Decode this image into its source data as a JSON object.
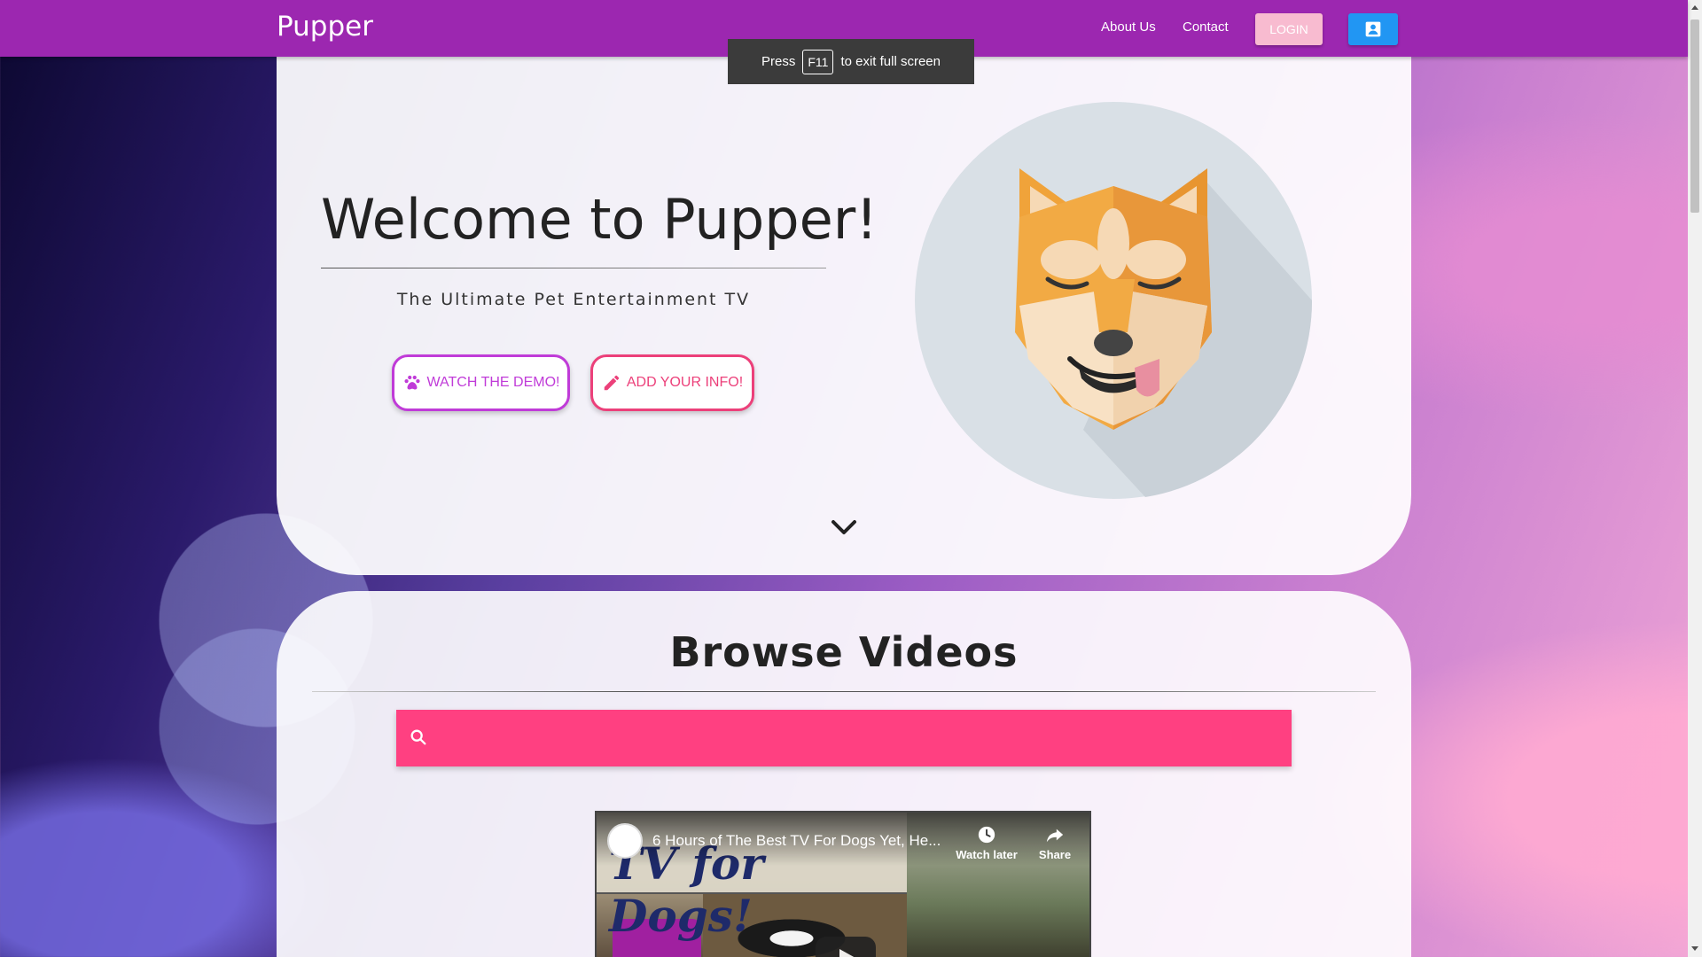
{
  "navbar": {
    "brand": "Pupper",
    "links": [
      "About Us",
      "Contact"
    ],
    "login_label": "LOGIN",
    "profile_icon": "account-box-icon",
    "color": "#9c27b0"
  },
  "toast": {
    "prefix": "Press",
    "key": "F11",
    "suffix": "to exit full screen"
  },
  "hero": {
    "title": "Welcome to Pupper!",
    "subtitle": "The Ultimate Pet Entertainment TV",
    "watch_demo_label": "WATCH THE DEMO!",
    "add_info_label": "ADD YOUR INFO!",
    "watch_demo_icon": "paw-icon",
    "add_info_icon": "pencil-icon",
    "scroll_icon": "chevron-down-icon"
  },
  "browse": {
    "title": "Browse Videos",
    "search_placeholder": "",
    "search_value": "",
    "search_color": "#ff4081"
  },
  "video": {
    "title": "6 Hours of The Best TV For Dogs Yet, He...",
    "thumbnail_text": "TV for Dogs!",
    "watch_later_label": "Watch later",
    "share_label": "Share"
  },
  "colors": {
    "purple": "#9c27b0",
    "pink": "#ff4081",
    "blue": "#2196f3",
    "login_pink": "#f8bbd0"
  }
}
